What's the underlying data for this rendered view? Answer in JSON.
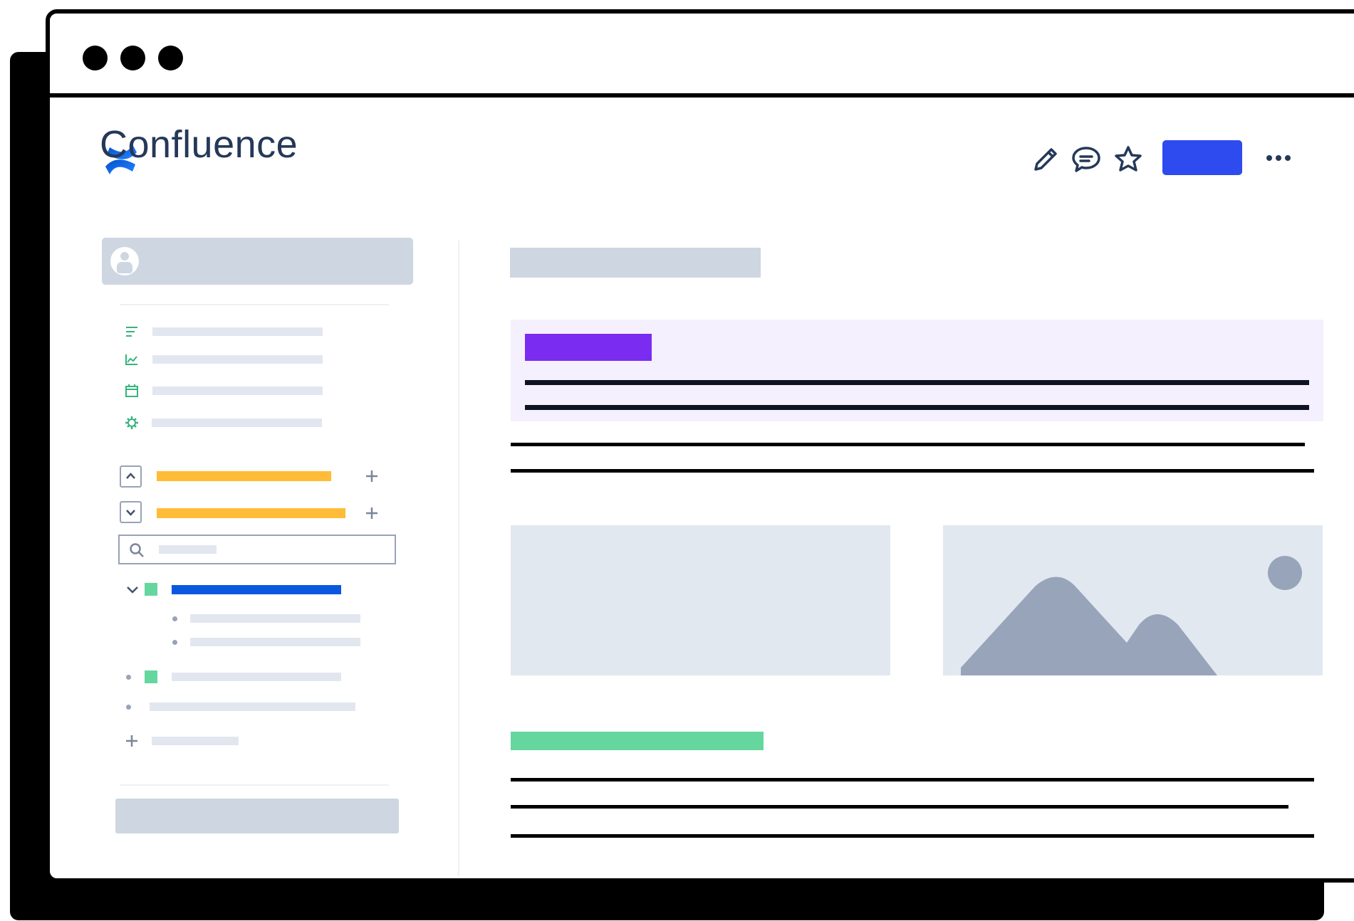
{
  "app": {
    "name": "Confluence",
    "brand_color": "#2684FF",
    "accent_color": "#2D4BEE"
  },
  "window": {
    "controls": [
      "window-dot",
      "window-dot",
      "window-dot"
    ]
  },
  "header": {
    "icons": [
      "pencil-icon",
      "comment-icon",
      "star-icon"
    ],
    "primary_button_label": "",
    "more_icon": "more-horizontal-icon"
  },
  "sidebar": {
    "nav_icons": [
      "list-icon",
      "chart-icon",
      "calendar-icon",
      "gear-icon"
    ],
    "sections_colors": {
      "highlight": "#FFBC36",
      "active_page": "#0A58E0",
      "page_badge": "#65D69E"
    },
    "search_placeholder": ""
  },
  "content": {
    "panel_color": "#F5F0FD",
    "panel_title_color": "#7A2CF0",
    "heading_color": "#65D69E"
  }
}
